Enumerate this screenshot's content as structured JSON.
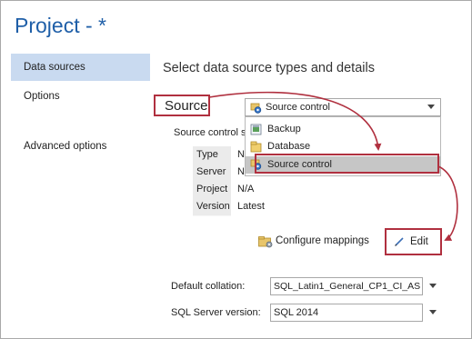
{
  "window": {
    "title": "Project - *"
  },
  "sidebar": {
    "items": [
      {
        "label": "Data sources",
        "selected": true
      },
      {
        "label": "Options",
        "selected": false
      },
      {
        "label": "Advanced options",
        "selected": false
      }
    ]
  },
  "main": {
    "heading": "Select data source types and details",
    "source_label": "Source",
    "source_dropdown": {
      "selected": "Source control",
      "icon": "source-control-icon",
      "options": [
        {
          "label": "Backup",
          "icon": "backup-icon"
        },
        {
          "label": "Database",
          "icon": "database-icon"
        },
        {
          "label": "Source control",
          "icon": "source-control-icon"
        }
      ]
    },
    "source_control_label": "Source control s",
    "properties": [
      {
        "key": "Type",
        "value": "N/A"
      },
      {
        "key": "Server",
        "value": "N/A"
      },
      {
        "key": "Project",
        "value": "N/A"
      },
      {
        "key": "Version",
        "value": "Latest"
      }
    ],
    "configure_mappings_label": "Configure mappings",
    "edit_label": "Edit",
    "default_collation_label": "Default collation:",
    "default_collation_value": "SQL_Latin1_General_CP1_CI_AS",
    "sql_server_version_label": "SQL Server version:",
    "sql_server_version_value": "SQL 2014"
  },
  "colors": {
    "accent": "#1f5fa8",
    "annotation": "#b0303f",
    "selection": "#c9daf0",
    "hover": "#c6c6c6"
  }
}
